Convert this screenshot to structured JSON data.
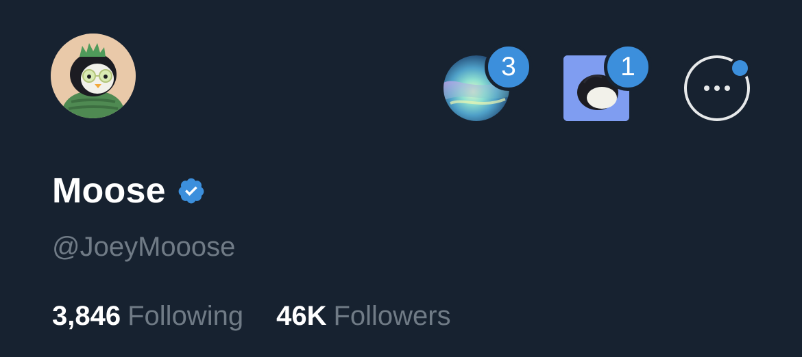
{
  "profile": {
    "display_name": "Moose",
    "handle": "@JoeyMooose",
    "verified_icon": "verified-badge-icon"
  },
  "header_actions": {
    "community_avatar": {
      "badge_count": "3",
      "icon": "aurora-community-avatar"
    },
    "penguin_avatar": {
      "badge_count": "1",
      "icon": "penguin-avatar"
    },
    "more_button": {
      "icon": "more-options-icon"
    }
  },
  "stats": {
    "following_count": "3,846",
    "following_label": "Following",
    "followers_count": "46K",
    "followers_label": "Followers"
  },
  "colors": {
    "background": "#172230",
    "accent_blue": "#3c8fdc",
    "primary_text": "#ffffff",
    "secondary_text": "#707b86"
  }
}
